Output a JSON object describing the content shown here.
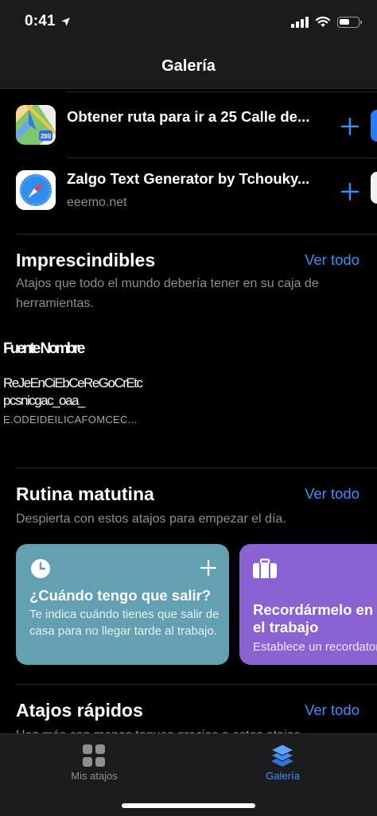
{
  "status": {
    "time": "0:41",
    "battery_level": 0.55
  },
  "nav": {
    "title": "Galería"
  },
  "recent": [
    {
      "title": "Obtener ruta para ir a 25 Calle de...",
      "subtitle": "",
      "icon": "maps-icon",
      "route_badge": "280"
    },
    {
      "title": "Zalgo Text Generator by Tchouky...",
      "subtitle": "eeemo.net",
      "icon": "safari-icon"
    }
  ],
  "essentials": {
    "title": "Imprescindibles",
    "see_all": "Ver todo",
    "description": "Atajos que todo el mundo debería tener en su caja de herramientas.",
    "glitch": {
      "line1": "Fuente Nombre",
      "line2": "ReJeEnCiEbCeReGoCrEtc",
      "line3": "pcsnicgac_oaa_",
      "line4": "E.ODEIDEILICAFOMCEC..."
    }
  },
  "morning": {
    "title": "Rutina matutina",
    "see_all": "Ver todo",
    "description": "Despierta con estos atajos para empezar el día.",
    "cards": [
      {
        "title": "¿Cuándo tengo que salir?",
        "description": "Te indica cuándo tienes que salir de casa para no llegar tarde al trabajo.",
        "color": "#62a0b2",
        "icon": "clock-icon"
      },
      {
        "title": "Recordármelo en el trabajo",
        "description": "Establece un recordatorio",
        "color": "#8a62d1",
        "icon": "briefcase-icon"
      }
    ]
  },
  "quick": {
    "title": "Atajos rápidos",
    "see_all": "Ver todo",
    "description": "Haz más con menos toques gracias a estos atajos."
  },
  "tabs": [
    {
      "label": "Mis atajos",
      "icon": "grid-icon",
      "active": false
    },
    {
      "label": "Galería",
      "icon": "layers-icon",
      "active": true
    }
  ],
  "colors": {
    "accent": "#3e8ef7",
    "inactive_tab": "#8e8e93"
  }
}
